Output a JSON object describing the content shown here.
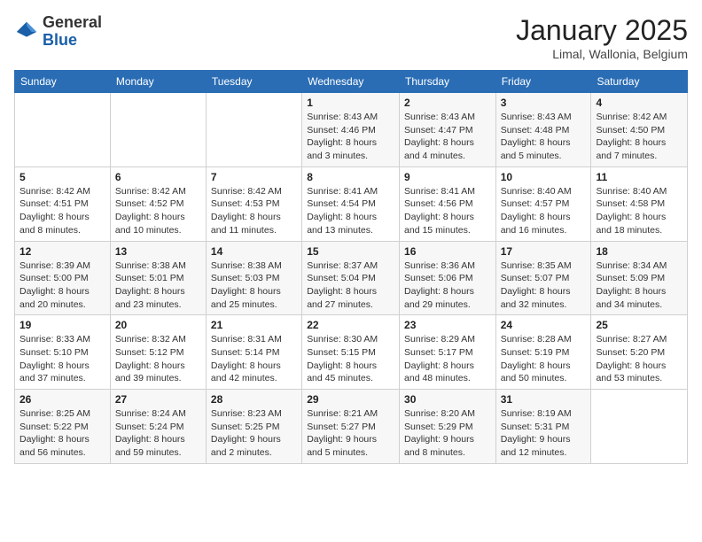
{
  "logo": {
    "general": "General",
    "blue": "Blue"
  },
  "title": "January 2025",
  "location": "Limal, Wallonia, Belgium",
  "weekdays": [
    "Sunday",
    "Monday",
    "Tuesday",
    "Wednesday",
    "Thursday",
    "Friday",
    "Saturday"
  ],
  "weeks": [
    [
      {
        "day": "",
        "info": ""
      },
      {
        "day": "",
        "info": ""
      },
      {
        "day": "",
        "info": ""
      },
      {
        "day": "1",
        "info": "Sunrise: 8:43 AM\nSunset: 4:46 PM\nDaylight: 8 hours\nand 3 minutes."
      },
      {
        "day": "2",
        "info": "Sunrise: 8:43 AM\nSunset: 4:47 PM\nDaylight: 8 hours\nand 4 minutes."
      },
      {
        "day": "3",
        "info": "Sunrise: 8:43 AM\nSunset: 4:48 PM\nDaylight: 8 hours\nand 5 minutes."
      },
      {
        "day": "4",
        "info": "Sunrise: 8:42 AM\nSunset: 4:50 PM\nDaylight: 8 hours\nand 7 minutes."
      }
    ],
    [
      {
        "day": "5",
        "info": "Sunrise: 8:42 AM\nSunset: 4:51 PM\nDaylight: 8 hours\nand 8 minutes."
      },
      {
        "day": "6",
        "info": "Sunrise: 8:42 AM\nSunset: 4:52 PM\nDaylight: 8 hours\nand 10 minutes."
      },
      {
        "day": "7",
        "info": "Sunrise: 8:42 AM\nSunset: 4:53 PM\nDaylight: 8 hours\nand 11 minutes."
      },
      {
        "day": "8",
        "info": "Sunrise: 8:41 AM\nSunset: 4:54 PM\nDaylight: 8 hours\nand 13 minutes."
      },
      {
        "day": "9",
        "info": "Sunrise: 8:41 AM\nSunset: 4:56 PM\nDaylight: 8 hours\nand 15 minutes."
      },
      {
        "day": "10",
        "info": "Sunrise: 8:40 AM\nSunset: 4:57 PM\nDaylight: 8 hours\nand 16 minutes."
      },
      {
        "day": "11",
        "info": "Sunrise: 8:40 AM\nSunset: 4:58 PM\nDaylight: 8 hours\nand 18 minutes."
      }
    ],
    [
      {
        "day": "12",
        "info": "Sunrise: 8:39 AM\nSunset: 5:00 PM\nDaylight: 8 hours\nand 20 minutes."
      },
      {
        "day": "13",
        "info": "Sunrise: 8:38 AM\nSunset: 5:01 PM\nDaylight: 8 hours\nand 23 minutes."
      },
      {
        "day": "14",
        "info": "Sunrise: 8:38 AM\nSunset: 5:03 PM\nDaylight: 8 hours\nand 25 minutes."
      },
      {
        "day": "15",
        "info": "Sunrise: 8:37 AM\nSunset: 5:04 PM\nDaylight: 8 hours\nand 27 minutes."
      },
      {
        "day": "16",
        "info": "Sunrise: 8:36 AM\nSunset: 5:06 PM\nDaylight: 8 hours\nand 29 minutes."
      },
      {
        "day": "17",
        "info": "Sunrise: 8:35 AM\nSunset: 5:07 PM\nDaylight: 8 hours\nand 32 minutes."
      },
      {
        "day": "18",
        "info": "Sunrise: 8:34 AM\nSunset: 5:09 PM\nDaylight: 8 hours\nand 34 minutes."
      }
    ],
    [
      {
        "day": "19",
        "info": "Sunrise: 8:33 AM\nSunset: 5:10 PM\nDaylight: 8 hours\nand 37 minutes."
      },
      {
        "day": "20",
        "info": "Sunrise: 8:32 AM\nSunset: 5:12 PM\nDaylight: 8 hours\nand 39 minutes."
      },
      {
        "day": "21",
        "info": "Sunrise: 8:31 AM\nSunset: 5:14 PM\nDaylight: 8 hours\nand 42 minutes."
      },
      {
        "day": "22",
        "info": "Sunrise: 8:30 AM\nSunset: 5:15 PM\nDaylight: 8 hours\nand 45 minutes."
      },
      {
        "day": "23",
        "info": "Sunrise: 8:29 AM\nSunset: 5:17 PM\nDaylight: 8 hours\nand 48 minutes."
      },
      {
        "day": "24",
        "info": "Sunrise: 8:28 AM\nSunset: 5:19 PM\nDaylight: 8 hours\nand 50 minutes."
      },
      {
        "day": "25",
        "info": "Sunrise: 8:27 AM\nSunset: 5:20 PM\nDaylight: 8 hours\nand 53 minutes."
      }
    ],
    [
      {
        "day": "26",
        "info": "Sunrise: 8:25 AM\nSunset: 5:22 PM\nDaylight: 8 hours\nand 56 minutes."
      },
      {
        "day": "27",
        "info": "Sunrise: 8:24 AM\nSunset: 5:24 PM\nDaylight: 8 hours\nand 59 minutes."
      },
      {
        "day": "28",
        "info": "Sunrise: 8:23 AM\nSunset: 5:25 PM\nDaylight: 9 hours\nand 2 minutes."
      },
      {
        "day": "29",
        "info": "Sunrise: 8:21 AM\nSunset: 5:27 PM\nDaylight: 9 hours\nand 5 minutes."
      },
      {
        "day": "30",
        "info": "Sunrise: 8:20 AM\nSunset: 5:29 PM\nDaylight: 9 hours\nand 8 minutes."
      },
      {
        "day": "31",
        "info": "Sunrise: 8:19 AM\nSunset: 5:31 PM\nDaylight: 9 hours\nand 12 minutes."
      },
      {
        "day": "",
        "info": ""
      }
    ]
  ]
}
